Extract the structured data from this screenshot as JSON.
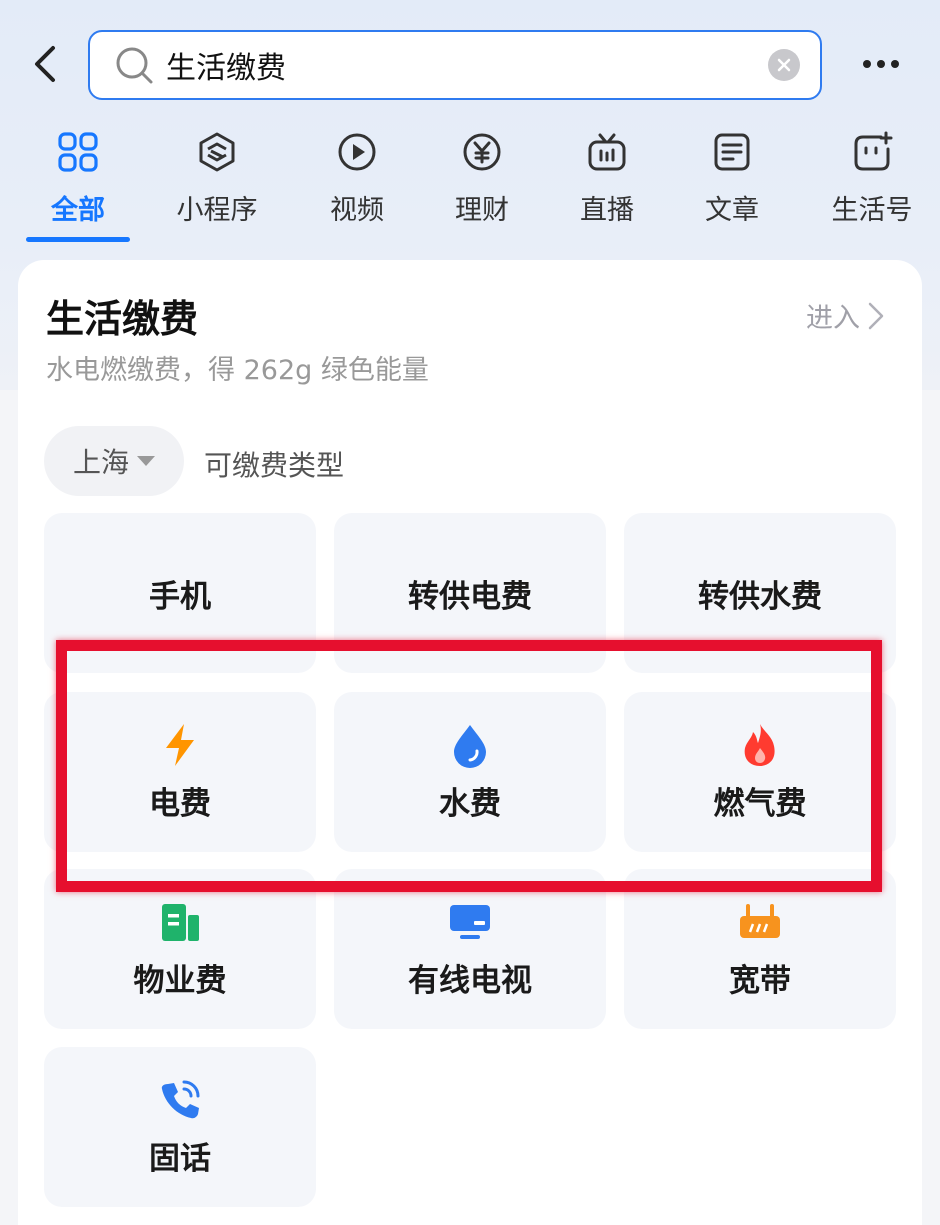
{
  "search": {
    "value": "生活缴费"
  },
  "tabs": [
    {
      "label": "全部",
      "icon": "grid-icon",
      "active": true
    },
    {
      "label": "小程序",
      "icon": "mini-program-icon"
    },
    {
      "label": "视频",
      "icon": "video-play-icon"
    },
    {
      "label": "理财",
      "icon": "yen-icon"
    },
    {
      "label": "直播",
      "icon": "live-tv-icon"
    },
    {
      "label": "文章",
      "icon": "article-icon"
    },
    {
      "label": "生活号",
      "icon": "life-account-icon"
    }
  ],
  "card": {
    "title": "生活缴费",
    "enter": "进入",
    "subtitle": "水电燃缴费，得 262g 绿色能量",
    "city": "上海",
    "types_label": "可缴费类型",
    "tiles": [
      {
        "label": "手机"
      },
      {
        "label": "转供电费"
      },
      {
        "label": "转供水费"
      },
      {
        "label": "电费",
        "icon": "lightning-icon"
      },
      {
        "label": "水费",
        "icon": "water-drop-icon"
      },
      {
        "label": "燃气费",
        "icon": "flame-icon"
      },
      {
        "label": "物业费",
        "icon": "building-icon"
      },
      {
        "label": "有线电视",
        "icon": "tv-icon"
      },
      {
        "label": "宽带",
        "icon": "router-icon"
      },
      {
        "label": "固话",
        "icon": "phone-icon"
      }
    ]
  },
  "colors": {
    "accent": "#1677ff",
    "highlight": "#e60f2e",
    "electric": "#ff9500",
    "water": "#2f7bf0",
    "gas": "#ff3b30",
    "property": "#1fb36b",
    "broadband": "#f7931e"
  }
}
